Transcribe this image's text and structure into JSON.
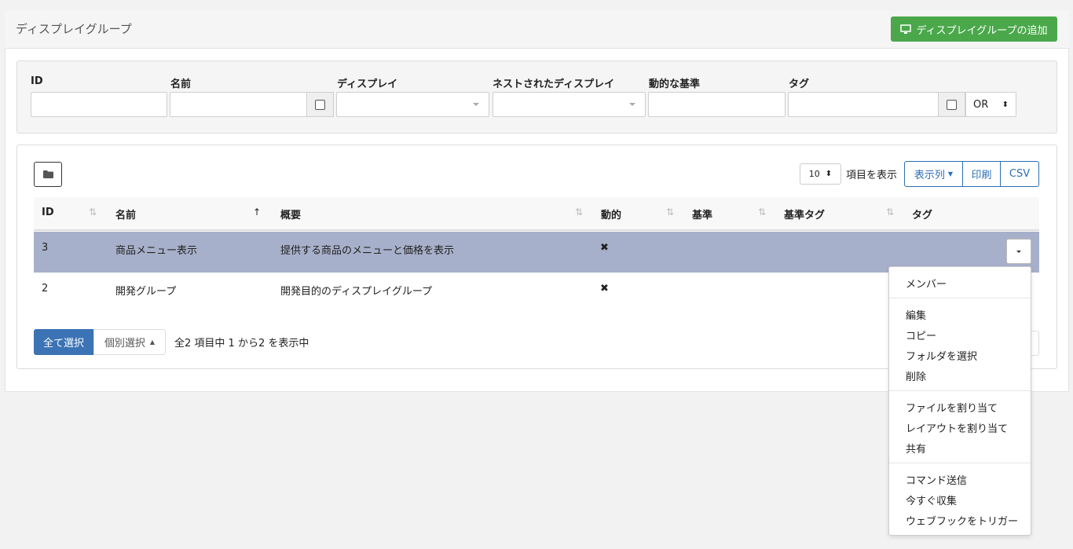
{
  "header": {
    "title": "ディスプレイグループ",
    "add_button": "ディスプレイグループの追加"
  },
  "filters": {
    "labels": [
      "ID",
      "名前",
      "ディスプレイ",
      "ネストされたディスプレイ",
      "動的な基準",
      "タグ"
    ],
    "logic_select": "OR"
  },
  "table_controls": {
    "page_length": "10",
    "page_length_suffix": "項目を表示",
    "columns_button": "表示列",
    "print_button": "印刷",
    "csv_button": "CSV"
  },
  "columns": [
    "ID",
    "名前",
    "概要",
    "動的",
    "基準",
    "基準タグ",
    "タグ"
  ],
  "rows": [
    {
      "id": "3",
      "name": "商品メニュー表示",
      "description": "提供する商品のメニューと価格を表示",
      "dynamic": "✖"
    },
    {
      "id": "2",
      "name": "開発グループ",
      "description": "開発目的のディスプレイグループ",
      "dynamic": "✖"
    }
  ],
  "footer": {
    "select_all": "全て選択",
    "select_each": "個別選択",
    "info": "全2 項目中 1 から2 を表示中"
  },
  "row_menu": {
    "items": [
      "メンバー",
      "編集",
      "コピー",
      "フォルダを選択",
      "削除",
      "ファイルを割り当て",
      "レイアウトを割り当て",
      "共有",
      "コマンド送信",
      "今すぐ収集",
      "ウェブフックをトリガー"
    ]
  },
  "icons": {
    "add": "monitor-icon",
    "folder": "folder-icon",
    "sort": "sort-icon",
    "sort_asc": "sort-asc-icon",
    "dropdown": "caret-down-icon"
  },
  "colors": {
    "add_button": "#4aa84a",
    "primary": "#3b73b5",
    "selected_row": "#a7b0ca"
  }
}
